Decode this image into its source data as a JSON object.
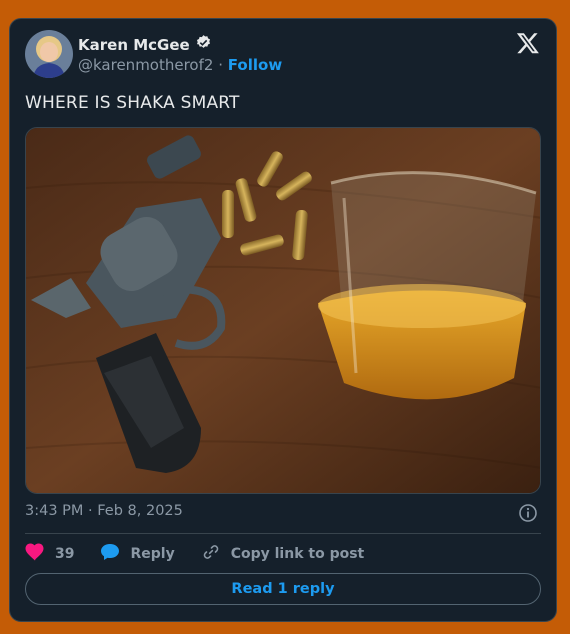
{
  "author": {
    "name": "Karen McGee",
    "handle": "@karenmotherof2",
    "separator": "·",
    "follow_label": "Follow",
    "verified_icon": "verified-badge-icon"
  },
  "tweet": {
    "text": "WHERE IS SHAKA SMART",
    "timestamp": "3:43 PM · Feb 8, 2025"
  },
  "actions": {
    "likes_count": "39",
    "reply_label": "Reply",
    "copy_link_label": "Copy link to post"
  },
  "read_reply_label": "Read 1 reply",
  "colors": {
    "background": "#c45c06",
    "card": "#15202b",
    "accent": "#1d9bf0",
    "like": "#f91880"
  }
}
